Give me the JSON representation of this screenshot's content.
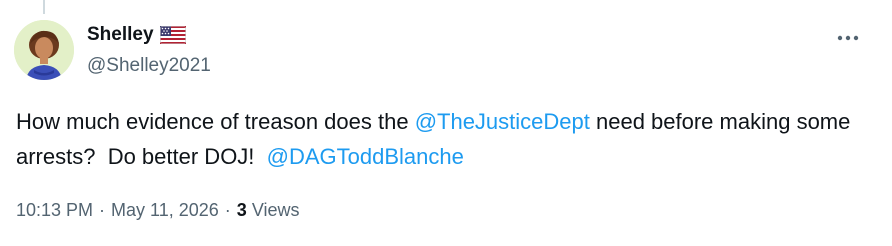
{
  "author": {
    "display_name": "Shelley",
    "handle": "@Shelley2021",
    "flag_icon": "us-flag-icon"
  },
  "tweet": {
    "text_part1": "How much evidence of treason does the ",
    "mention1": "@TheJusticeDept",
    "text_part2": " need before making some arrests?  Do better DOJ!  ",
    "mention2": "@DAGToddBlanche"
  },
  "meta": {
    "time": "10:13 PM",
    "separator": "·",
    "date": "May 11, 2026",
    "views_count": "3",
    "views_label": "Views"
  },
  "icons": {
    "more": "more-horizontal-icon"
  },
  "colors": {
    "link": "#1d9bf0",
    "secondary_text": "#536471",
    "primary_text": "#0f1419"
  }
}
